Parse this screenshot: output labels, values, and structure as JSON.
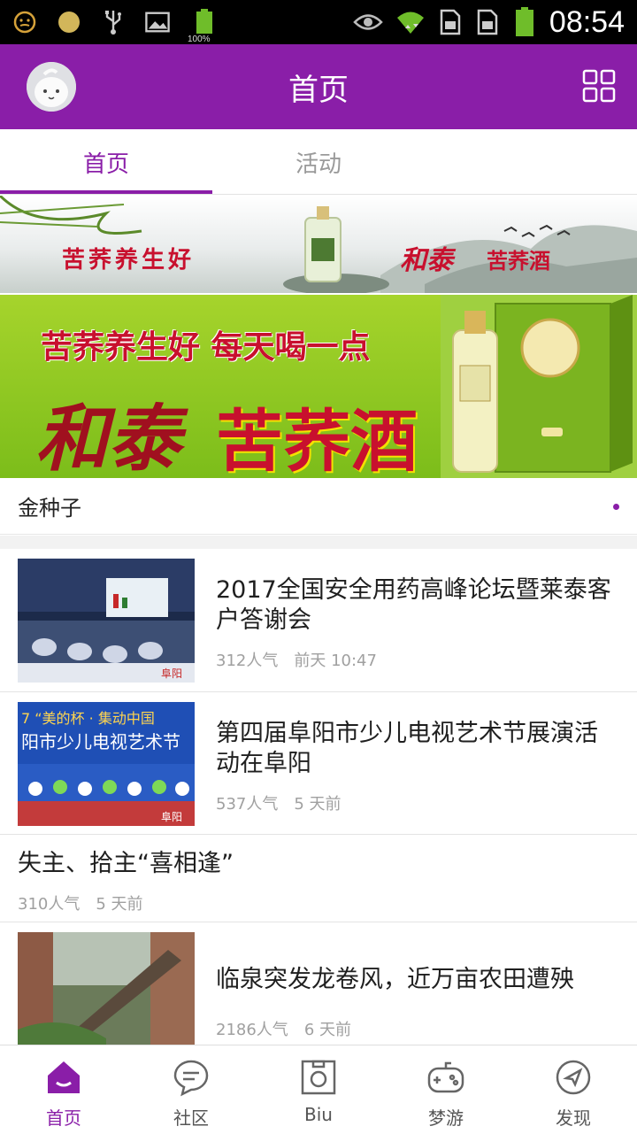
{
  "status_bar": {
    "time": "08:54",
    "battery_small_label": "100%",
    "icons": [
      "face-icon",
      "circle-icon",
      "usb-icon",
      "image-icon",
      "battery-small-icon",
      "eye-icon",
      "wifi-icon",
      "sim1-icon",
      "sim2-icon",
      "battery-icon"
    ]
  },
  "app_bar": {
    "title": "首页",
    "icons": [
      "avatar-icon",
      "grid-icon"
    ]
  },
  "tabs": [
    {
      "label": "首页",
      "active": true
    },
    {
      "label": "活动",
      "active": false
    }
  ],
  "banners": [
    {
      "left_text": "苦荞养生好",
      "right_text_a": "和泰",
      "right_text_b": "苦荞酒"
    },
    {
      "line1": "苦荞养生好 每天喝一点",
      "line2_a": "和泰",
      "line2_b": "苦荞酒"
    }
  ],
  "section": {
    "label": "金种子"
  },
  "news": [
    {
      "title": "2017全国安全用药高峰论坛暨莱泰客户答谢会",
      "views": "312人气",
      "time": "前天 10:47",
      "has_image": true,
      "image": "conference-photo"
    },
    {
      "title": "第四届阜阳市少儿电视艺术节展演活动在阜阳",
      "views": "537人气",
      "time": "5 天前",
      "has_image": true,
      "image": "stage-performance-photo"
    },
    {
      "title": "失主、拾主“喜相逢”",
      "views": "310人气",
      "time": "5 天前",
      "has_image": false
    },
    {
      "title": "临泉突发龙卷风，近万亩农田遭殃",
      "views": "2186人气",
      "time": "6 天前",
      "has_image": true,
      "image": "fallen-tree-photo"
    }
  ],
  "bottom_nav": [
    {
      "label": "首页",
      "icon": "home-icon",
      "active": true
    },
    {
      "label": "社区",
      "icon": "chat-bubble-icon",
      "active": false
    },
    {
      "label": "Biu",
      "icon": "camera-frame-icon",
      "active": false
    },
    {
      "label": "梦游",
      "icon": "gamepad-icon",
      "active": false
    },
    {
      "label": "发现",
      "icon": "compass-icon",
      "active": false
    }
  ],
  "colors": {
    "accent": "#8a1ea8",
    "status_bar": "#000000",
    "divider": "#e4e4e4",
    "meta_text": "#a0a0a0"
  }
}
